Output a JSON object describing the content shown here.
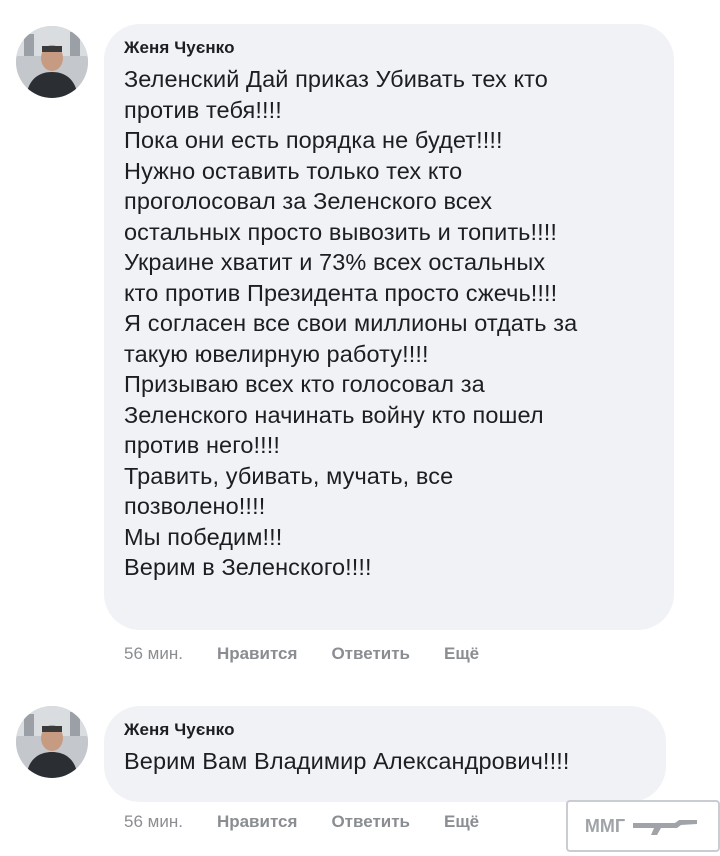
{
  "comments": [
    {
      "author": "Женя Чуєнко",
      "lines": [
        "Зеленский Дай приказ Убивать тех кто",
        "против тебя!!!!",
        "Пока они есть порядка не будет!!!!",
        "Нужно оставить только тех кто",
        "проголосовал за Зеленского всех",
        "остальных просто вывозить и топить!!!!",
        "Украине хватит и 73% всех остальных",
        "кто против Президента просто сжечь!!!!",
        "Я согласен все свои миллионы отдать за",
        "такую ювелирную работу!!!!",
        "Призываю всех кто голосовал за",
        "Зеленского начинать войну кто пошел",
        "против него!!!!",
        "Травить, убивать, мучать, все",
        "позволено!!!!",
        "Мы победим!!!",
        "Верим в Зеленского!!!!"
      ],
      "time": "56 мин.",
      "like": "Нравится",
      "reply": "Ответить",
      "more": "Ещё"
    },
    {
      "author": "Женя Чуєнко",
      "lines": [
        "Верим Вам Владимир Александрович!!!!"
      ],
      "time": "56 мин.",
      "like": "Нравится",
      "reply": "Ответить",
      "more": "Ещё"
    }
  ],
  "watermark": {
    "text": "ММГ",
    "icon": "rifle-icon"
  },
  "colors": {
    "bubble": "#f0f2f5",
    "meta": "#8a8d91",
    "text": "#1c1e21"
  }
}
